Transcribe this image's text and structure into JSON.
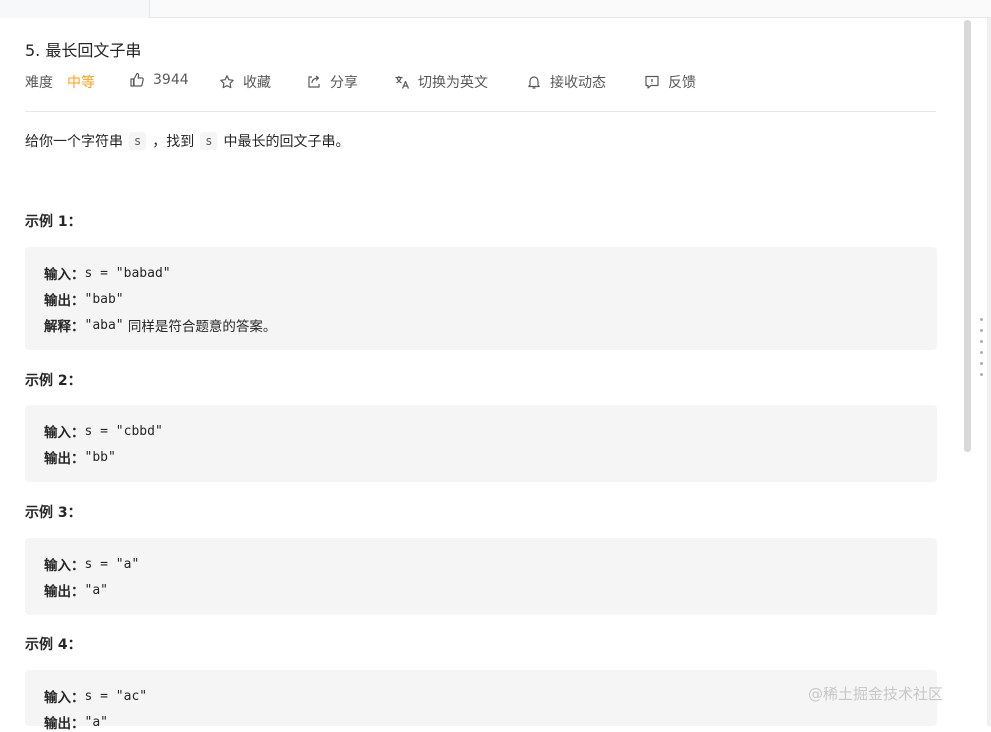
{
  "problem": {
    "title": "5. 最长回文子串",
    "difficulty_label": "难度",
    "difficulty_value": "中等",
    "likes": "3944",
    "collect_label": "收藏",
    "share_label": "分享",
    "translate_label": "切换为英文",
    "subscribe_label": "接收动态",
    "feedback_label": "反馈"
  },
  "description": {
    "prefix": "给你一个字符串",
    "var_s": "s",
    "middle": "，找到",
    "var_s2": "s",
    "suffix": "中最长的回文子串。"
  },
  "examples": [
    {
      "title": "示例 1：",
      "input_key": "输入：",
      "input_val": "s = \"babad\"",
      "output_key": "输出：",
      "output_val": "\"bab\"",
      "explain_key": "解释：",
      "explain_val": "\"aba\"",
      "explain_note": " 同样是符合题意的答案。"
    },
    {
      "title": "示例 2：",
      "input_key": "输入：",
      "input_val": "s = \"cbbd\"",
      "output_key": "输出：",
      "output_val": "\"bb\""
    },
    {
      "title": "示例 3：",
      "input_key": "输入：",
      "input_val": "s = \"a\"",
      "output_key": "输出：",
      "output_val": "\"a\""
    },
    {
      "title": "示例 4：",
      "input_key": "输入：",
      "input_val": "s = \"ac\"",
      "output_key": "输出：",
      "output_val": "\"a\""
    }
  ],
  "watermark": "@稀土掘金技术社区",
  "colors": {
    "accent": "#ffa116",
    "text": "#262626",
    "muted": "#595959",
    "code_bg": "#f5f5f5"
  },
  "icons": [
    "thumbs-up-icon",
    "star-icon",
    "share-icon",
    "translate-icon",
    "bell-icon",
    "feedback-icon"
  ]
}
